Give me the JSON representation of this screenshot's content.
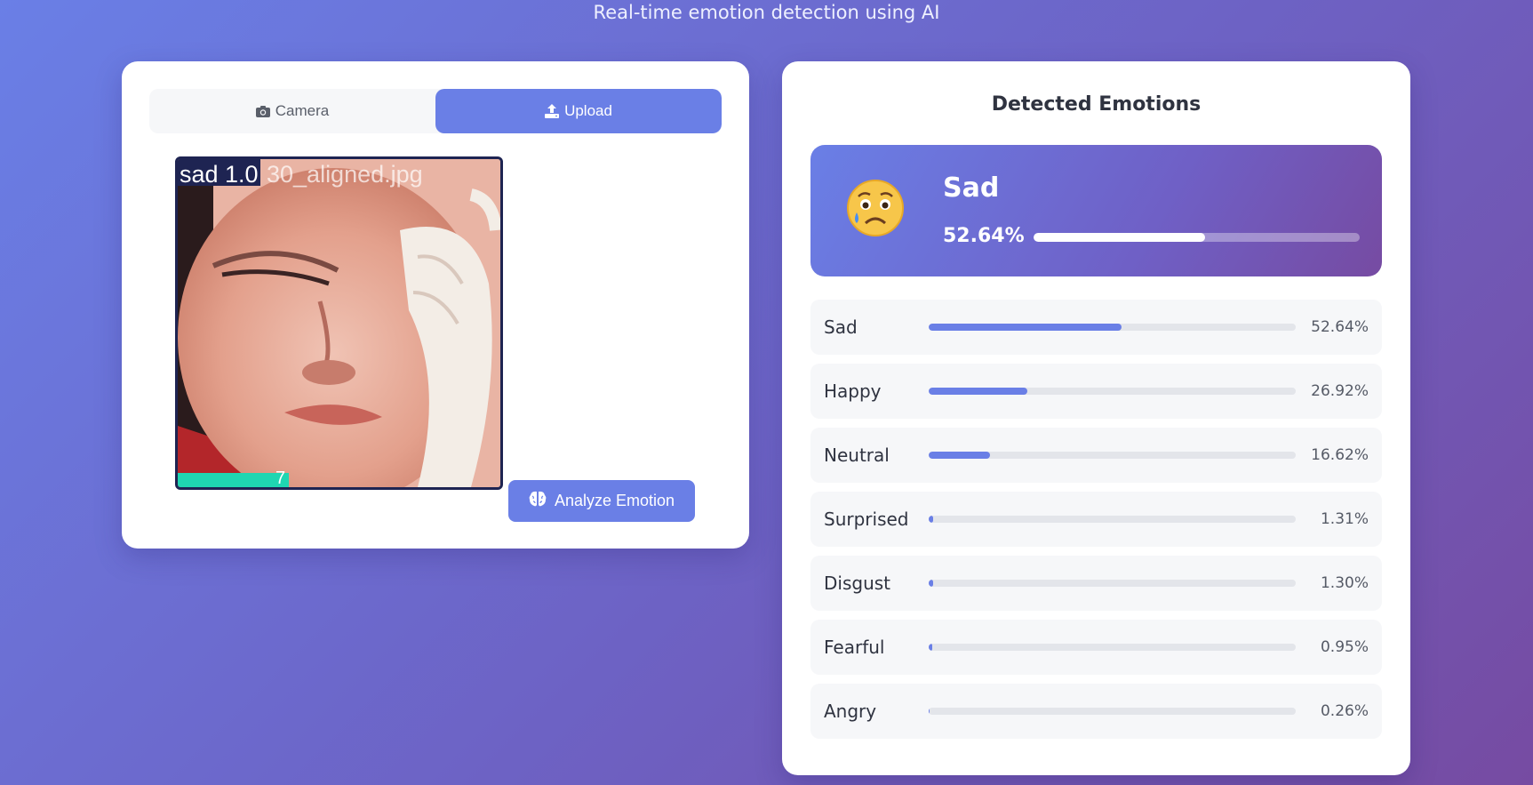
{
  "header": {
    "subtitle": "Real-time emotion detection using AI"
  },
  "input_panel": {
    "tabs": [
      {
        "label": "Camera",
        "icon": "camera-icon",
        "active": false
      },
      {
        "label": "Upload",
        "icon": "upload-icon",
        "active": true
      }
    ],
    "preview": {
      "detection_label": "sad 1.0",
      "filename_overlay": "30_aligned.jpg",
      "bottom_overlay": "7"
    },
    "analyze_button": {
      "label": "Analyze Emotion",
      "icon": "brain-icon"
    }
  },
  "results_panel": {
    "title": "Detected Emotions",
    "top_result": {
      "emoji": "😥",
      "label": "Sad",
      "percent_text": "52.64%",
      "percent": 52.64
    },
    "emotions": [
      {
        "name": "Sad",
        "percent_text": "52.64%",
        "percent": 52.64
      },
      {
        "name": "Happy",
        "percent_text": "26.92%",
        "percent": 26.92
      },
      {
        "name": "Neutral",
        "percent_text": "16.62%",
        "percent": 16.62
      },
      {
        "name": "Surprised",
        "percent_text": "1.31%",
        "percent": 1.31
      },
      {
        "name": "Disgust",
        "percent_text": "1.30%",
        "percent": 1.3
      },
      {
        "name": "Fearful",
        "percent_text": "0.95%",
        "percent": 0.95
      },
      {
        "name": "Angry",
        "percent_text": "0.26%",
        "percent": 0.26
      }
    ]
  },
  "colors": {
    "accent": "#6a7fe6",
    "gradient_start": "#667eea",
    "gradient_end": "#764ba2",
    "detection_box": "#1e2452",
    "detection_secondary": "#1fd6b2"
  }
}
